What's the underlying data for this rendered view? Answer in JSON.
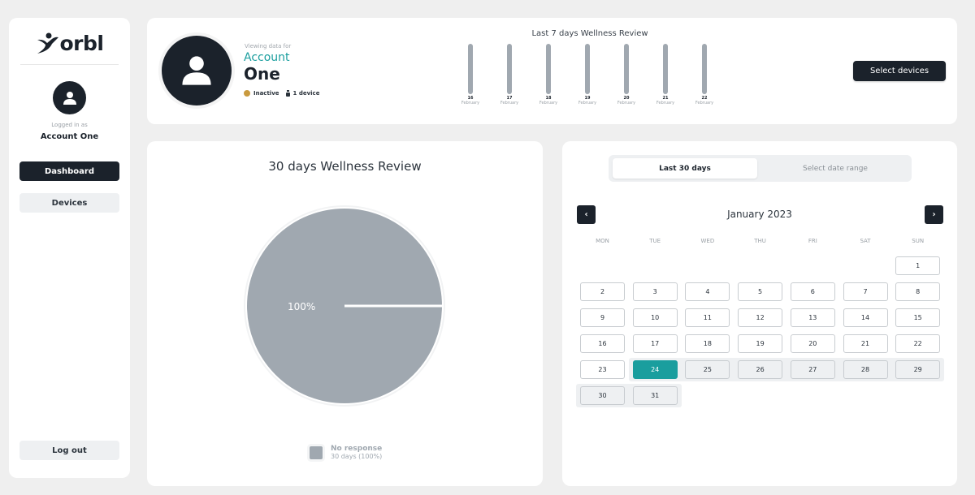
{
  "sidebar": {
    "logo": "orbl",
    "logged_in_label": "Logged in as",
    "account_name": "Account One",
    "nav": [
      {
        "label": "Dashboard",
        "active": true
      },
      {
        "label": "Devices",
        "active": false
      }
    ],
    "logout_label": "Log out"
  },
  "header": {
    "viewing_label": "Viewing data for",
    "account_first": "Account",
    "account_second": "One",
    "status": "Inactive",
    "status_color": "#c99a3e",
    "device_count": "1 device",
    "select_devices_label": "Select devices",
    "week_review": {
      "title": "Last 7 days Wellness Review",
      "days": [
        {
          "day": "16",
          "month": "February",
          "value": 1
        },
        {
          "day": "17",
          "month": "February",
          "value": 1
        },
        {
          "day": "18",
          "month": "February",
          "value": 1
        },
        {
          "day": "19",
          "month": "February",
          "value": 1
        },
        {
          "day": "20",
          "month": "February",
          "value": 1
        },
        {
          "day": "21",
          "month": "February",
          "value": 1
        },
        {
          "day": "22",
          "month": "February",
          "value": 1
        }
      ]
    }
  },
  "pie": {
    "title": "30 days Wellness Review",
    "slice_label": "100%",
    "legend": [
      {
        "name": "No response",
        "detail": "30 days (100%)",
        "color": "#a0a8b0"
      }
    ]
  },
  "chart_data": {
    "type": "pie",
    "title": "30 days Wellness Review",
    "categories": [
      "No response"
    ],
    "values": [
      100
    ],
    "unit": "%",
    "days": [
      30
    ],
    "legend": "bottom"
  },
  "calendar": {
    "tabs": [
      {
        "label": "Last 30 days",
        "active": true
      },
      {
        "label": "Select date range",
        "active": false
      }
    ],
    "month_title": "January 2023",
    "prev_icon": "‹",
    "next_icon": "›",
    "weekdays": [
      "MON",
      "TUE",
      "WED",
      "THU",
      "FRI",
      "SAT",
      "SUN"
    ],
    "first_weekday_index": 6,
    "days_in_month": 31,
    "selected_day": 24,
    "range_start": 24,
    "range_end": 31,
    "accent_color": "#1a9e9e"
  }
}
